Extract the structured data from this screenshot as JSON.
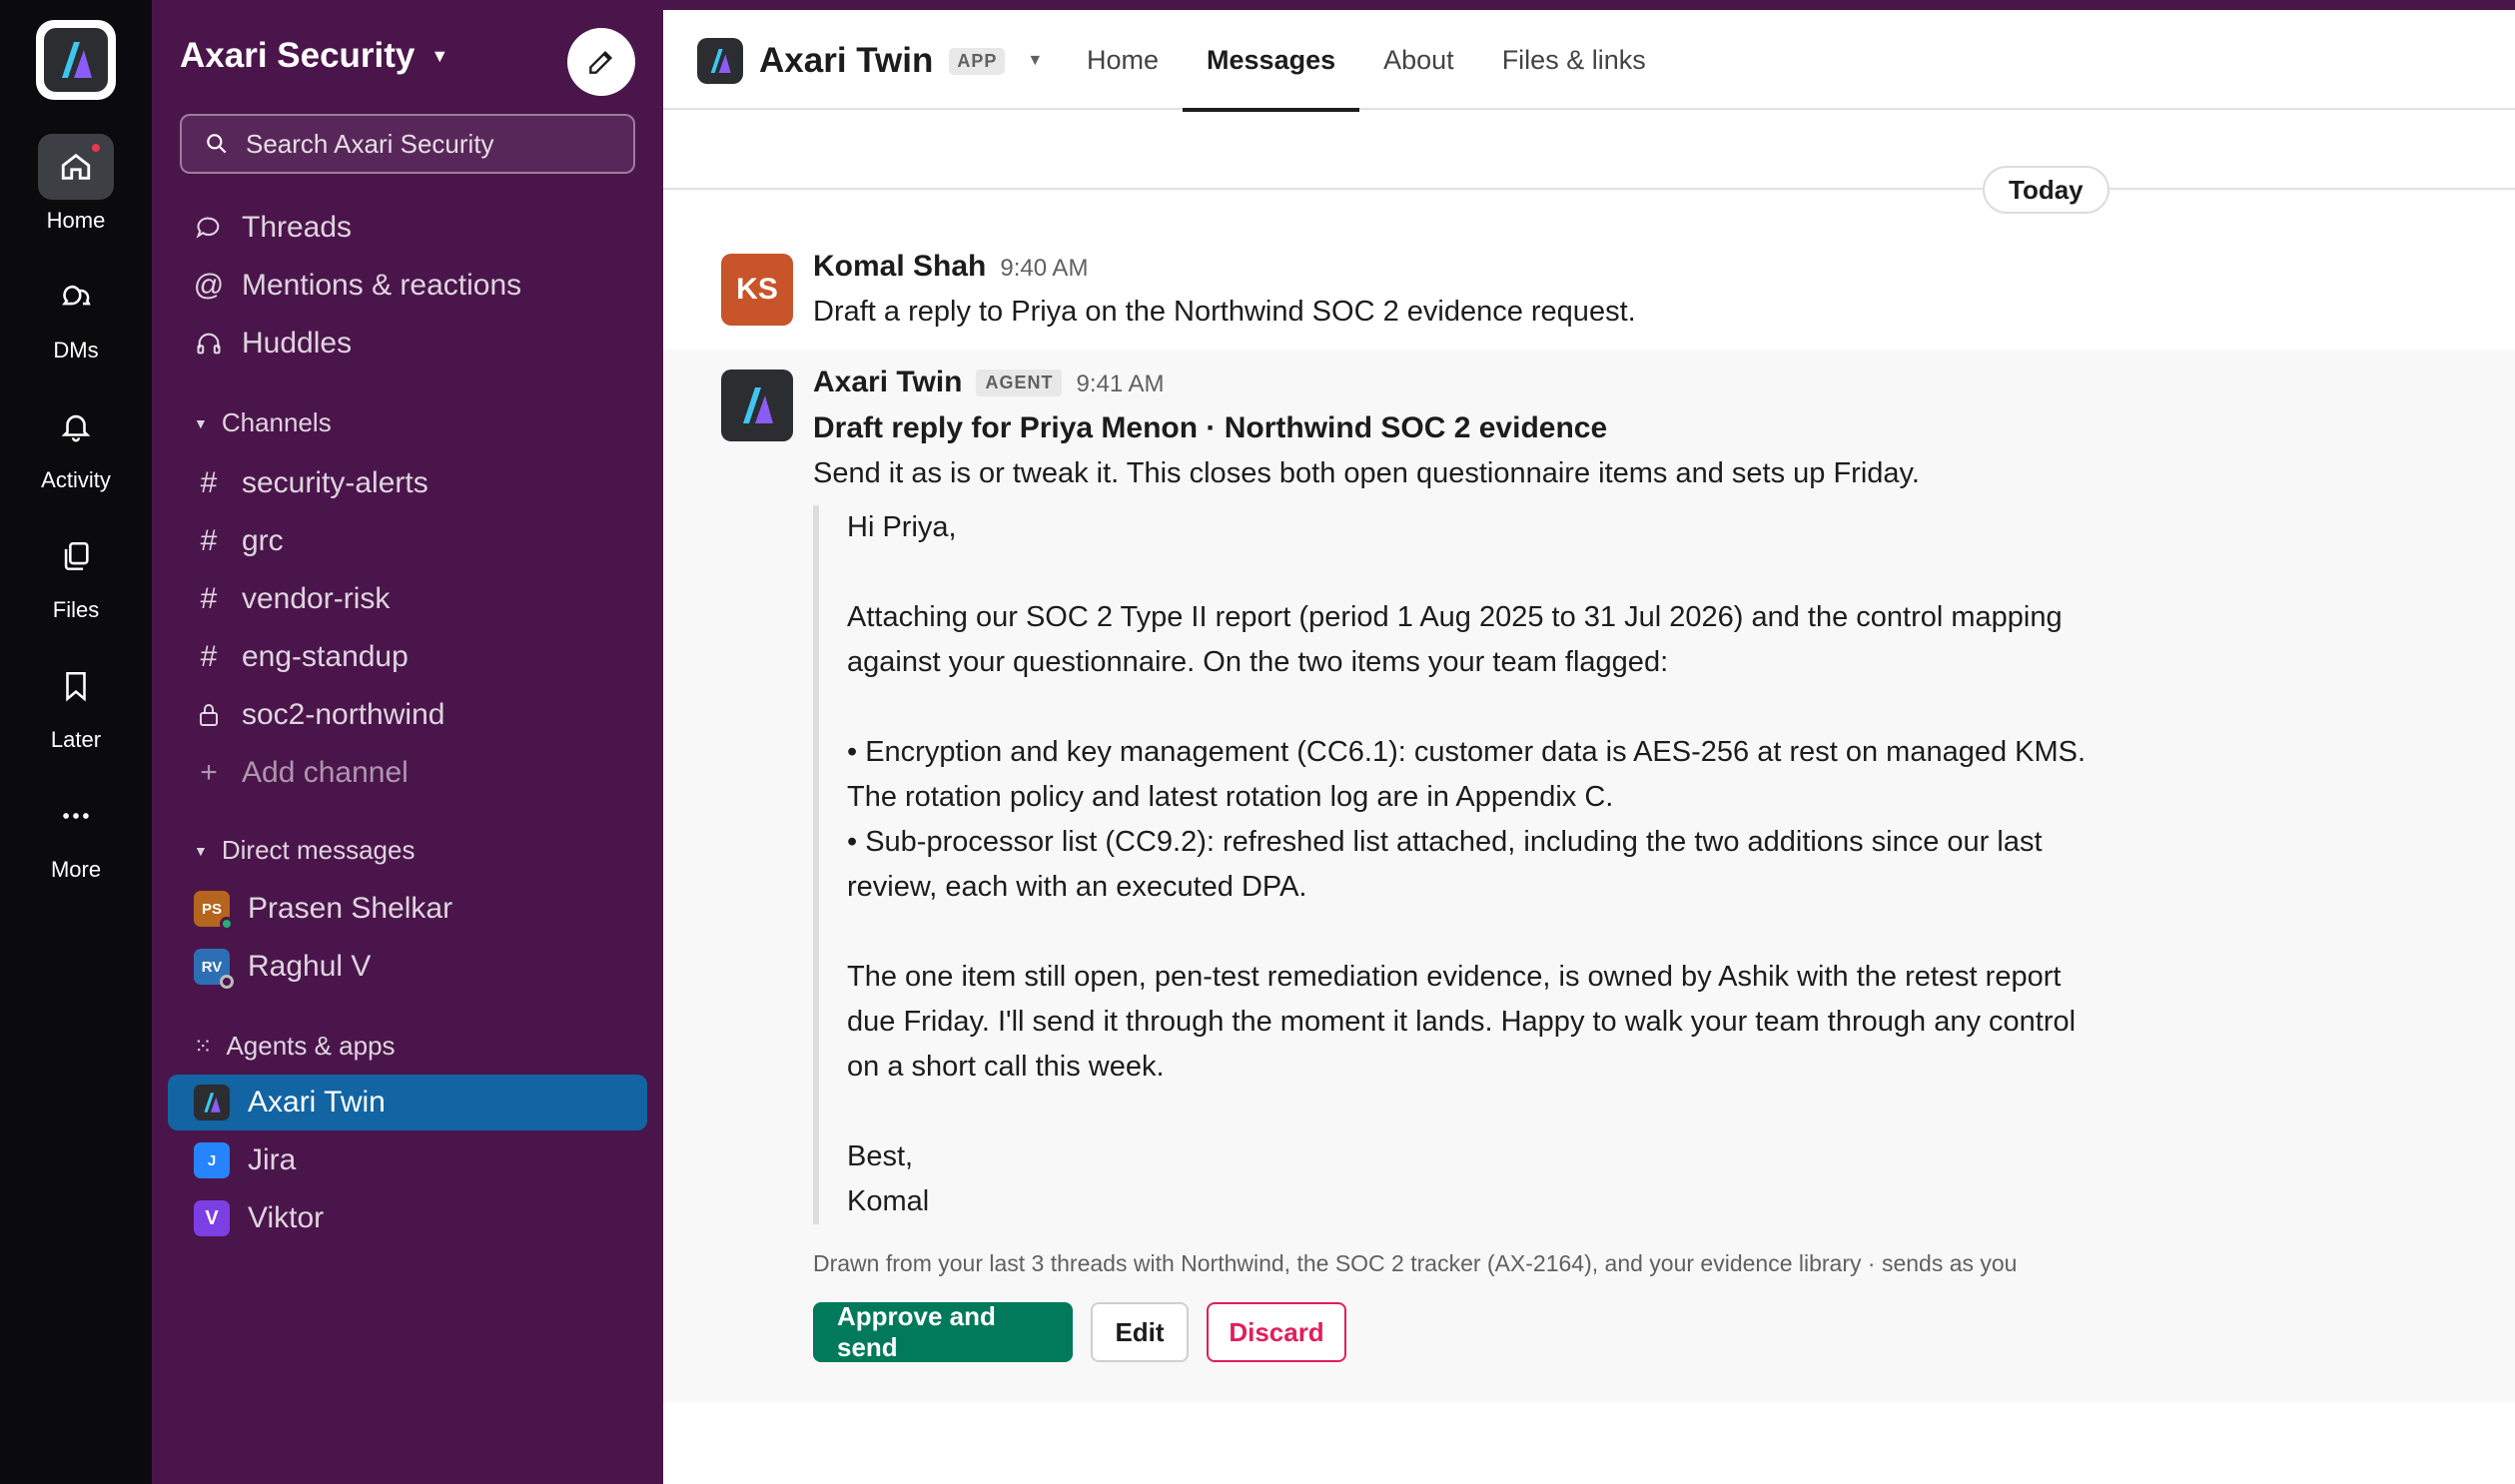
{
  "rail": {
    "items": [
      {
        "label": "Home",
        "icon": "home-icon"
      },
      {
        "label": "DMs",
        "icon": "dm-icon"
      },
      {
        "label": "Activity",
        "icon": "bell-icon"
      },
      {
        "label": "Files",
        "icon": "files-icon"
      },
      {
        "label": "Later",
        "icon": "bookmark-icon"
      },
      {
        "label": "More",
        "icon": "more-icon"
      }
    ]
  },
  "sidebar": {
    "workspace": "Axari Security",
    "search_placeholder": "Search Axari Security",
    "nav": [
      "Threads",
      "Mentions & reactions",
      "Huddles"
    ],
    "channels_header": "Channels",
    "channels": [
      "security-alerts",
      "grc",
      "vendor-risk",
      "eng-standup",
      "soc2-northwind"
    ],
    "add_channel": "Add channel",
    "dm_header": "Direct messages",
    "dms": [
      {
        "name": "Prasen Shelkar",
        "initials": "PS",
        "color": "#b5651d"
      },
      {
        "name": "Raghul V",
        "initials": "RV",
        "color": "#2d6fb5"
      }
    ],
    "apps_header": "Agents & apps",
    "apps": [
      {
        "name": "Axari Twin"
      },
      {
        "name": "Jira",
        "initials": "J",
        "color": "#2684ff"
      },
      {
        "name": "Viktor",
        "initials": "V",
        "color": "#7b3fe4"
      }
    ]
  },
  "header": {
    "title": "Axari Twin",
    "tag": "APP",
    "tabs": [
      "Home",
      "Messages",
      "About",
      "Files & links"
    ],
    "active_tab": "Messages"
  },
  "conversation": {
    "day": "Today",
    "msg1": {
      "author": "Komal Shah",
      "initials": "KS",
      "avatar_color": "#c8542a",
      "time": "9:40 AM",
      "text": "Draft a reply to Priya on the Northwind SOC 2 evidence request."
    },
    "msg2": {
      "author": "Axari Twin",
      "tag": "AGENT",
      "time": "9:41 AM",
      "title": "Draft reply for Priya Menon · Northwind SOC 2 evidence",
      "subtitle": "Send it as is or tweak it. This closes both open questionnaire items and sets up Friday.",
      "draft_lines": [
        "Hi Priya,",
        "",
        "Attaching our SOC 2 Type II report (period 1 Aug 2025 to 31 Jul 2026) and the control mapping",
        "against your questionnaire. On the two items your team flagged:",
        "",
        "• Encryption and key management (CC6.1): customer data is AES-256 at rest on managed KMS.",
        "The rotation policy and latest rotation log are in Appendix C.",
        "• Sub-processor list (CC9.2): refreshed list attached, including the two additions since our last",
        "review, each with an executed DPA.",
        "",
        "The one item still open, pen-test remediation evidence, is owned by Ashik with the retest report",
        "due Friday. I'll send it through the moment it lands. Happy to walk your team through any control",
        "on a short call this week.",
        "",
        "Best,",
        "Komal"
      ],
      "provenance": "Drawn from your last 3 threads with Northwind, the SOC 2 tracker (AX-2164), and your evidence library · sends as you",
      "approve_label": "Approve and send",
      "edit_label": "Edit",
      "discard_label": "Discard"
    }
  },
  "colors": {
    "sidebar": "#4a154b",
    "active_item": "#1264a3",
    "approve": "#007a5a",
    "discard": "#e01e5a"
  }
}
